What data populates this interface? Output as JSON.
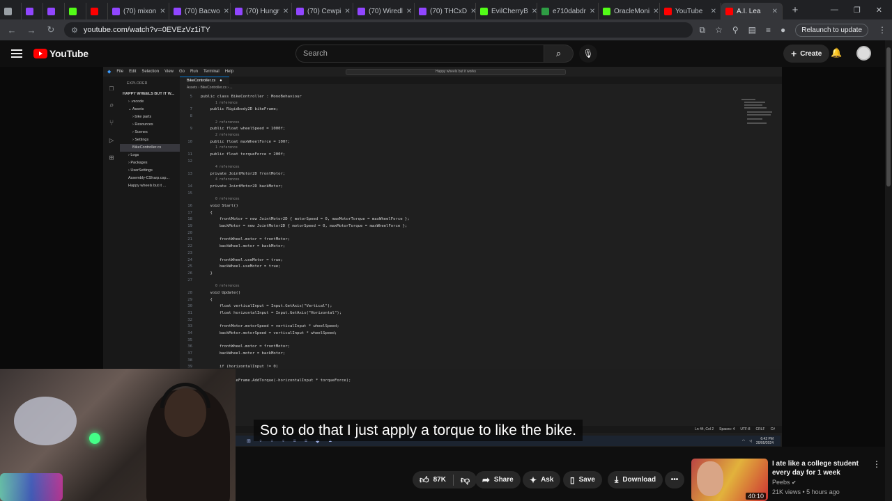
{
  "browser": {
    "tabs": [
      {
        "label": "",
        "color": "#9aa0a6"
      },
      {
        "label": "",
        "color": "#9146ff"
      },
      {
        "label": "",
        "color": "#9146ff"
      },
      {
        "label": "",
        "color": "#53fc18"
      },
      {
        "label": "",
        "color": "#ff0000"
      },
      {
        "label": "(70) mixon",
        "color": "#9146ff"
      },
      {
        "label": "(70) Bacwo",
        "color": "#9146ff"
      },
      {
        "label": "(70) Hungr",
        "color": "#9146ff"
      },
      {
        "label": "(70) Cewpi",
        "color": "#9146ff"
      },
      {
        "label": "(70) Wiredl",
        "color": "#9146ff"
      },
      {
        "label": "(70) THCxD",
        "color": "#9146ff"
      },
      {
        "label": "EvilCherryB",
        "color": "#53fc18"
      },
      {
        "label": "e710dabdr",
        "color": "#2e9d44"
      },
      {
        "label": "OracleMoni",
        "color": "#53fc18"
      },
      {
        "label": "YouTube",
        "color": "#ff0000"
      },
      {
        "label": "A.I. Lea",
        "color": "#ff0000"
      }
    ],
    "url": "youtube.com/watch?v=0EVEzVz1iTY",
    "relaunch_label": "Relaunch to update"
  },
  "youtube": {
    "logo_text": "YouTube",
    "search_placeholder": "Search",
    "create_label": "Create"
  },
  "vscode": {
    "menu": [
      "File",
      "Edit",
      "Selection",
      "View",
      "Go",
      "Run",
      "Terminal",
      "Help"
    ],
    "command_center": "Happy wheels but it works",
    "explorer_title": "EXPLORER",
    "project_title": "HAPPY WHEELS BUT IT W...",
    "tree": [
      {
        "label": "› .vscode",
        "indent": 12
      },
      {
        "label": "⌄ Assets",
        "indent": 12
      },
      {
        "label": "› bike parts",
        "indent": 18
      },
      {
        "label": "› Resources",
        "indent": 18
      },
      {
        "label": "› Scenes",
        "indent": 18
      },
      {
        "label": "› Settings",
        "indent": 18
      },
      {
        "label": "BikeController.cs",
        "indent": 18,
        "selected": true
      },
      {
        "label": "› Logs",
        "indent": 12
      },
      {
        "label": "› Packages",
        "indent": 12
      },
      {
        "label": "› UserSettings",
        "indent": 12
      },
      {
        "label": "Assembly-CSharp.csp...",
        "indent": 12
      },
      {
        "label": "Happy wheels but it ...",
        "indent": 12
      }
    ],
    "tab_name": "BikeController.cs",
    "breadcrumb": "Assets › BikeController.cs › ...",
    "code": [
      {
        "n": "5",
        "t": "public class BikeController : MonoBehaviour"
      },
      {
        "ref": "1 reference"
      },
      {
        "n": "7",
        "t": "    public Rigidbody2D bikeFrame;"
      },
      {
        "n": "8",
        "t": ""
      },
      {
        "ref": "2 references"
      },
      {
        "n": "9",
        "t": "    public float wheelSpeed = 1000f;"
      },
      {
        "ref": "2 references"
      },
      {
        "n": "10",
        "t": "    public float maxWheelForce = 100f;"
      },
      {
        "ref": "1 reference"
      },
      {
        "n": "11",
        "t": "    public float torqueForce = 200f;"
      },
      {
        "n": "12",
        "t": ""
      },
      {
        "ref": "4 references"
      },
      {
        "n": "13",
        "t": "    private JointMotor2D frontMotor;"
      },
      {
        "ref": "4 references"
      },
      {
        "n": "14",
        "t": "    private JointMotor2D backMotor;"
      },
      {
        "n": "15",
        "t": ""
      },
      {
        "ref": "0 references"
      },
      {
        "n": "16",
        "t": "    void Start()"
      },
      {
        "n": "17",
        "t": "    {"
      },
      {
        "n": "18",
        "t": "        frontMotor = new JointMotor2D { motorSpeed = 0, maxMotorTorque = maxWheelForce };"
      },
      {
        "n": "19",
        "t": "        backMotor = new JointMotor2D { motorSpeed = 0, maxMotorTorque = maxWheelForce };"
      },
      {
        "n": "20",
        "t": ""
      },
      {
        "n": "21",
        "t": "        frontWheel.motor = frontMotor;"
      },
      {
        "n": "22",
        "t": "        backWheel.motor = backMotor;"
      },
      {
        "n": "23",
        "t": ""
      },
      {
        "n": "24",
        "t": "        frontWheel.useMotor = true;"
      },
      {
        "n": "25",
        "t": "        backWheel.useMotor = true;"
      },
      {
        "n": "26",
        "t": "    }"
      },
      {
        "n": "27",
        "t": ""
      },
      {
        "ref": "0 references"
      },
      {
        "n": "28",
        "t": "    void Update()"
      },
      {
        "n": "29",
        "t": "    {"
      },
      {
        "n": "30",
        "t": "        float verticalInput = Input.GetAxis(\"Vertical\");"
      },
      {
        "n": "31",
        "t": "        float horizontalInput = Input.GetAxis(\"Horizontal\");"
      },
      {
        "n": "32",
        "t": ""
      },
      {
        "n": "33",
        "t": "        frontMotor.motorSpeed = verticalInput * wheelSpeed;"
      },
      {
        "n": "34",
        "t": "        backMotor.motorSpeed = verticalInput * wheelSpeed;"
      },
      {
        "n": "35",
        "t": ""
      },
      {
        "n": "36",
        "t": "        frontWheel.motor = frontMotor;"
      },
      {
        "n": "37",
        "t": "        backWheel.motor = backMotor;"
      },
      {
        "n": "38",
        "t": ""
      },
      {
        "n": "39",
        "t": "        if (horizontalInput != 0)"
      },
      {
        "n": "40",
        "t": "        {"
      },
      {
        "n": "41",
        "t": "            bikeFrame.AddTorque(-horizontalInput * torqueForce);"
      }
    ],
    "status": [
      "Ln 44, Col 2",
      "Spaces: 4",
      "UTF-8",
      "CRLF",
      "C#"
    ],
    "clock": {
      "time": "6:42 PM",
      "date": "20/05/2024"
    }
  },
  "player": {
    "subtitle": "So to do that I just apply a torque to like the bike."
  },
  "actions": {
    "likes": "87K",
    "share": "Share",
    "ask": "Ask",
    "save": "Save",
    "download": "Download"
  },
  "up_next": {
    "title": "I ate like a college student every day for 1 week",
    "channel": "Peebs",
    "meta": "21K views • 5 hours ago",
    "duration": "40:10"
  }
}
